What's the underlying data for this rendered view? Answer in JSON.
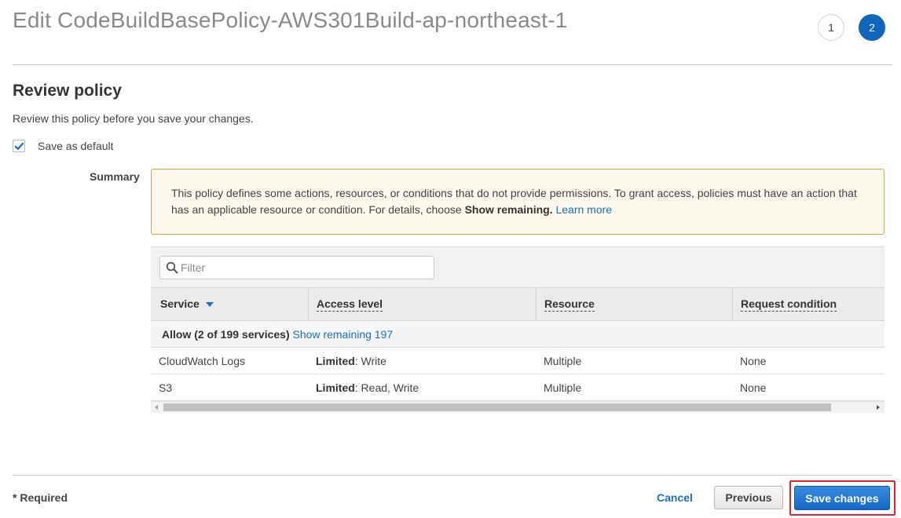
{
  "header": {
    "title": "Edit CodeBuildBasePolicy-AWS301Build-ap-northeast-1",
    "steps": [
      "1",
      "2"
    ],
    "active_step": "2"
  },
  "review": {
    "title": "Review policy",
    "description": "Review this policy before you save your changes.",
    "save_as_default_label": "Save as default",
    "save_as_default_checked": true
  },
  "summary": {
    "label": "Summary",
    "notice_text": "This policy defines some actions, resources, or conditions that do not provide permissions. To grant access, policies must have an action that has an applicable resource or condition. For details, choose",
    "notice_bold": "Show remaining.",
    "notice_link": "Learn more"
  },
  "table": {
    "filter_placeholder": "Filter",
    "columns": [
      "Service",
      "Access level",
      "Resource",
      "Request condition"
    ],
    "group": {
      "label": "Allow (2 of 199 services)",
      "link": "Show remaining 197"
    },
    "rows": [
      {
        "service": "CloudWatch Logs",
        "access_bold": "Limited",
        "access_rest": ": Write",
        "resource": "Multiple",
        "condition": "None"
      },
      {
        "service": "S3",
        "access_bold": "Limited",
        "access_rest": ": Read, Write",
        "resource": "Multiple",
        "condition": "None"
      }
    ]
  },
  "footer": {
    "required_label": "* Required",
    "cancel_label": "Cancel",
    "previous_label": "Previous",
    "save_label": "Save changes"
  },
  "colors": {
    "accent": "#1066bb",
    "link": "#1a6fc4",
    "highlight": "#e2262e",
    "notice_border": "#d8a24a"
  }
}
